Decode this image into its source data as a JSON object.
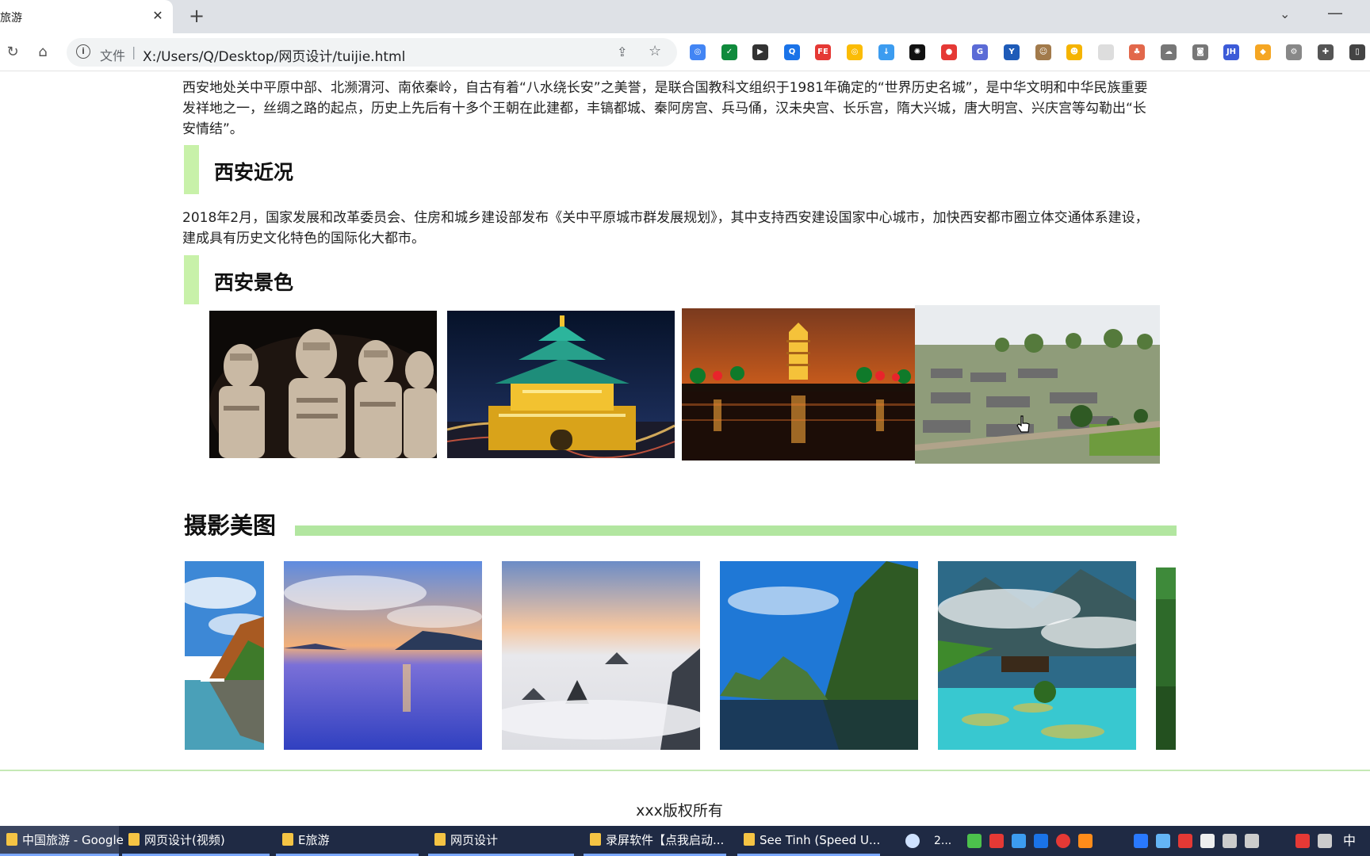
{
  "browser": {
    "tab_title": "中国旅游 - Google Chrome",
    "tab_title_visible": "旅游",
    "close_glyph": "✕",
    "new_tab_glyph": "+",
    "tab_search_glyph": "⌄",
    "minimize_glyph": "—",
    "back_glyph": "↻",
    "home_glyph": "⌂",
    "info_glyph": "i",
    "file_label": "文件",
    "separator": "|",
    "url": "X:/Users/Q/Desktop/网页设计/tuijie.html",
    "share_glyph": "⇪",
    "star_glyph": "☆",
    "extensions": [
      {
        "name": "chrome-ext-1",
        "color": "#4285f4",
        "glyph": "◎"
      },
      {
        "name": "shield-ext",
        "color": "#0f8a3c",
        "glyph": "✓"
      },
      {
        "name": "dark-ext",
        "color": "#333333",
        "glyph": "▶"
      },
      {
        "name": "q-ext",
        "color": "#1a73e8",
        "glyph": "Q"
      },
      {
        "name": "fe-ext",
        "color": "#e53935",
        "glyph": "FE"
      },
      {
        "name": "chrome-ext-2",
        "color": "#fbbc05",
        "glyph": "◎"
      },
      {
        "name": "download-ext",
        "color": "#3c9cf0",
        "glyph": "↓"
      },
      {
        "name": "openai-ext",
        "color": "#111111",
        "glyph": "✺"
      },
      {
        "name": "stop-ext",
        "color": "#e53935",
        "glyph": "●"
      },
      {
        "name": "g-ext",
        "color": "#5b6bd6",
        "glyph": "G"
      },
      {
        "name": "y-ext",
        "color": "#1e5bb8",
        "glyph": "Y"
      },
      {
        "name": "owl-ext",
        "color": "#a27a4b",
        "glyph": "☺"
      },
      {
        "name": "yellow-ext",
        "color": "#f5b400",
        "glyph": "☻"
      },
      {
        "name": "blank-ext",
        "color": "#dddddd",
        "glyph": ""
      },
      {
        "name": "tree-ext",
        "color": "#e2684b",
        "glyph": "♣"
      },
      {
        "name": "cloud-ext",
        "color": "#777777",
        "glyph": "☁"
      },
      {
        "name": "camera-ext",
        "color": "#777777",
        "glyph": "◙"
      },
      {
        "name": "jh-ext",
        "color": "#3c5bd8",
        "glyph": "JH"
      },
      {
        "name": "orange-ext",
        "color": "#f5a623",
        "glyph": "◆"
      },
      {
        "name": "gear-ext",
        "color": "#888888",
        "glyph": "⚙"
      },
      {
        "name": "puzzle-ext",
        "color": "#555555",
        "glyph": "✚"
      },
      {
        "name": "panel-ext",
        "color": "#444444",
        "glyph": "▯"
      }
    ]
  },
  "page": {
    "intro": "西安地处关中平原中部、北濒渭河、南依秦岭，自古有着“八水绕长安”之美誉，是联合国教科文组织于1981年确定的“世界历史名城”，是中华文明和中华民族重要发祥地之一，丝绸之路的起点，历史上先后有十多个王朝在此建都，丰镐都城、秦阿房宫、兵马俑，汉未央宫、长乐宫，隋大兴城，唐大明宫、兴庆宫等勾勒出“长安情结”。",
    "section_recent_title": "西安近况",
    "section_recent_body": "2018年2月，国家发展和改革委员会、住房和城乡建设部发布《关中平原城市群发展规划》，其中支持西安建设国家中心城市，加快西安都市圈立体交通体系建设，建成具有历史文化特色的国际化大都市。",
    "section_scenery_title": "西安景色",
    "gallery_title": "摄影美图",
    "footer": "xxx版权所有"
  },
  "taskbar": {
    "items": [
      {
        "label": "中国旅游 - Google ...",
        "active": true
      },
      {
        "label": "网页设计(视频)",
        "active": false
      },
      {
        "label": "E旅游",
        "active": false
      },
      {
        "label": "网页设计",
        "active": false
      },
      {
        "label": "录屏软件【点我启动...",
        "active": false
      },
      {
        "label": "See Tinh (Speed U...",
        "active": false
      }
    ],
    "tray_text": "2...",
    "ime": "中"
  }
}
